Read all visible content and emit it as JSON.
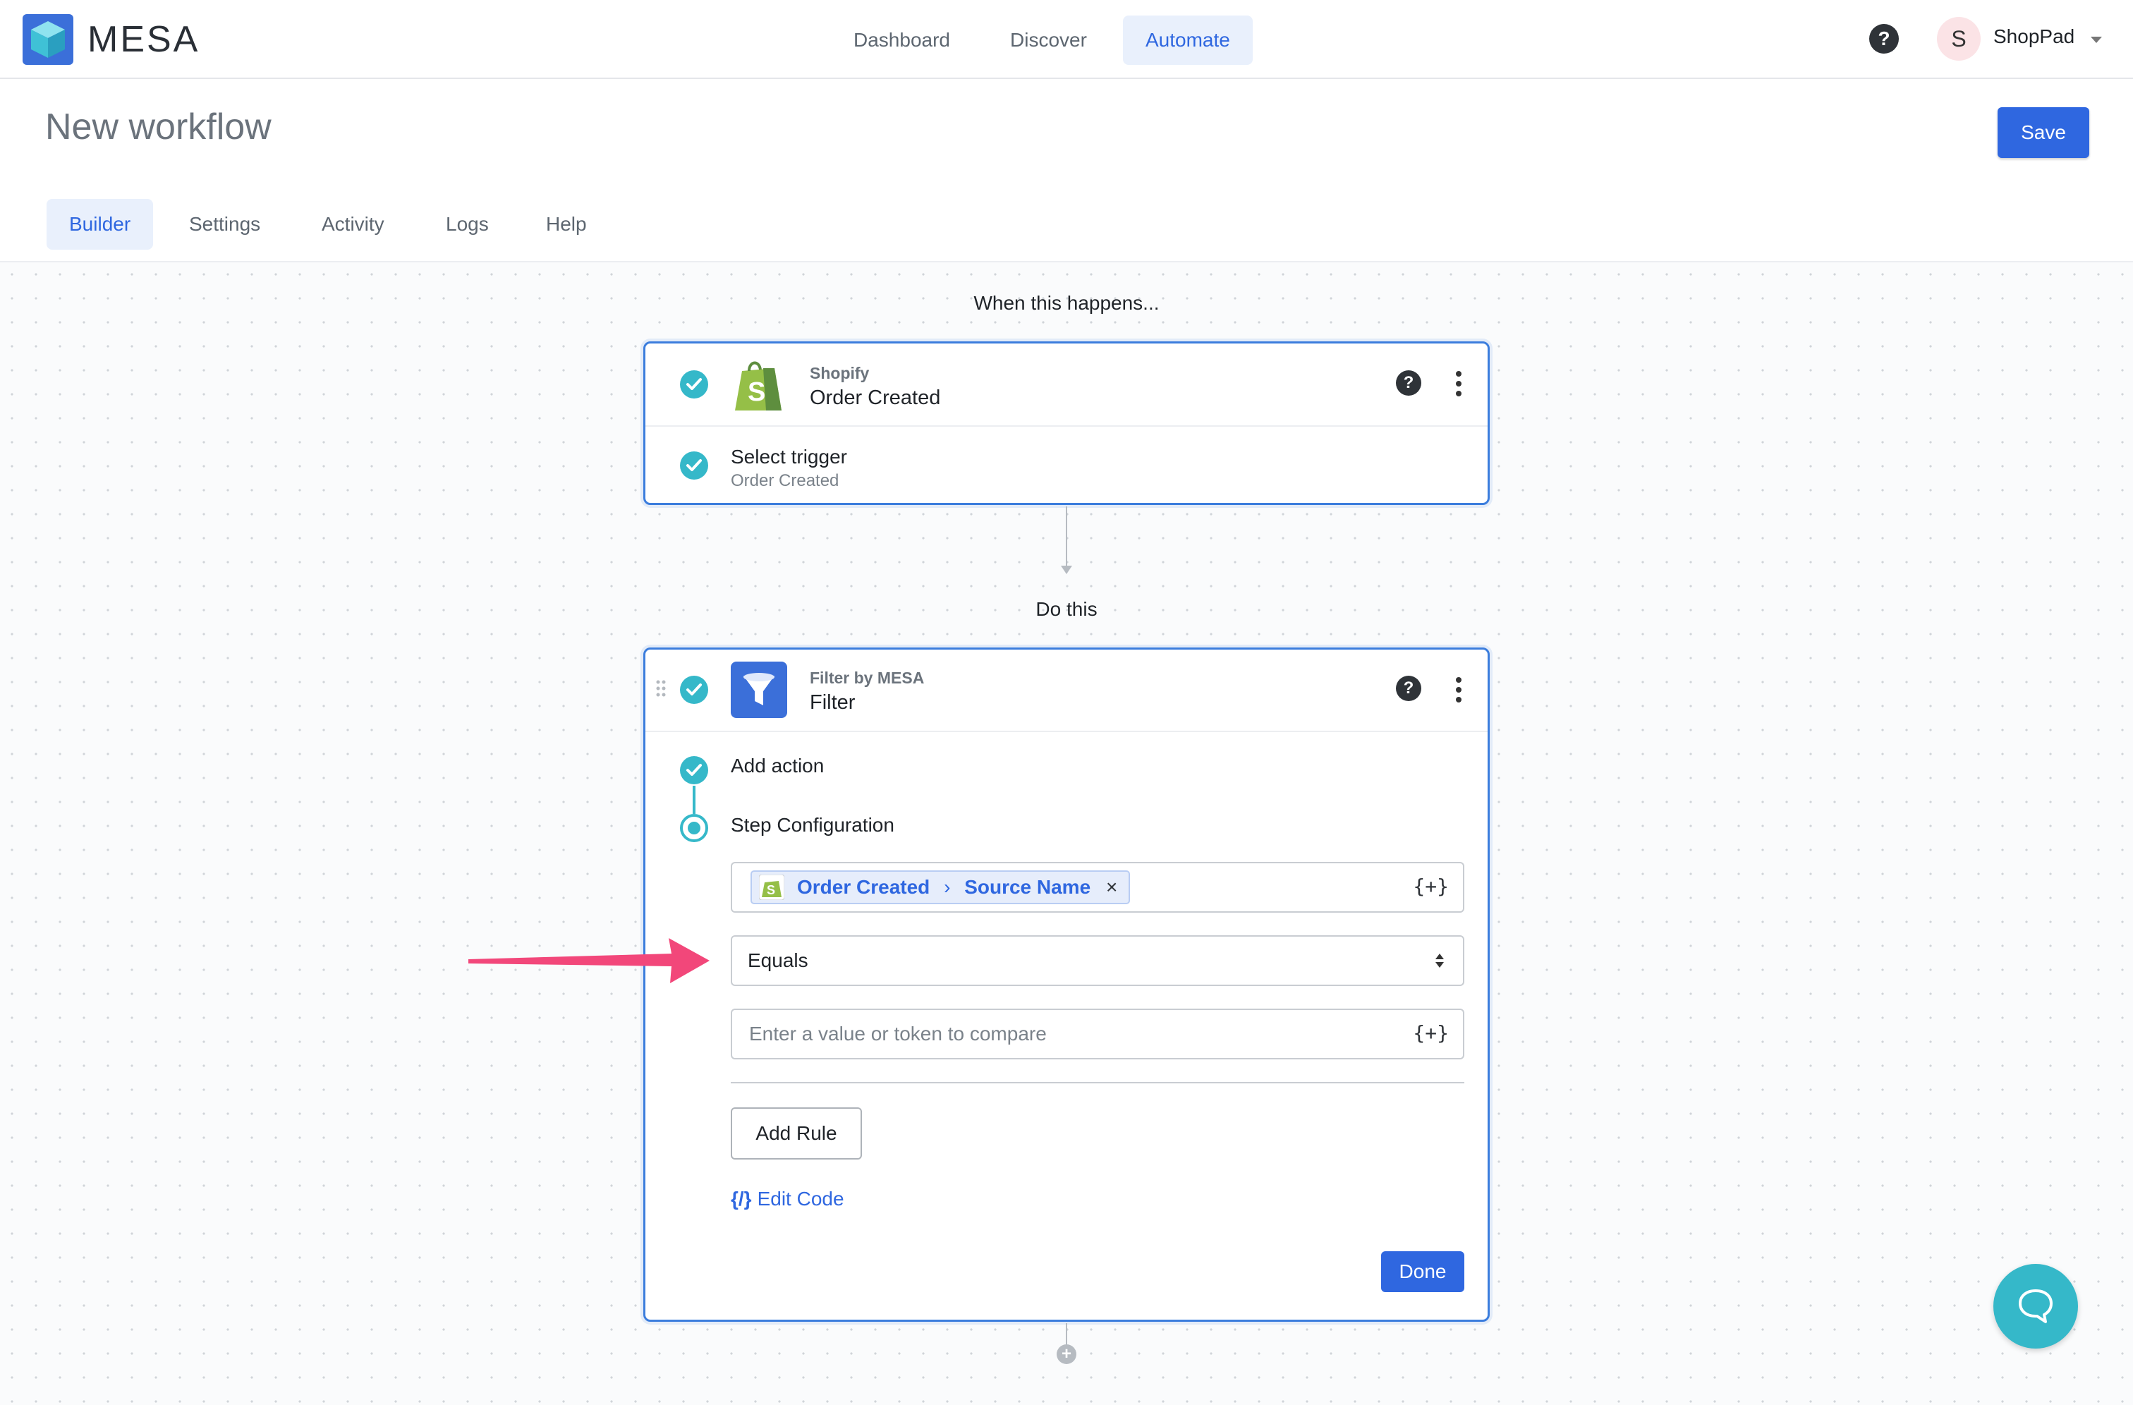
{
  "app": {
    "brand": "MESA",
    "accent": "#2f67e0",
    "teal": "#35b8c9"
  },
  "nav": {
    "tabs": [
      {
        "label": "Dashboard",
        "active": false
      },
      {
        "label": "Discover",
        "active": false
      },
      {
        "label": "Automate",
        "active": true
      }
    ],
    "help_icon": "question-circle-icon",
    "user_initial": "S",
    "shop_name": "ShopPad"
  },
  "header": {
    "title": "New workflow",
    "save_label": "Save"
  },
  "subtabs": [
    {
      "label": "Builder",
      "active": true
    },
    {
      "label": "Settings",
      "active": false
    },
    {
      "label": "Activity",
      "active": false
    },
    {
      "label": "Logs",
      "active": false
    },
    {
      "label": "Help",
      "active": false
    }
  ],
  "trigger": {
    "section_label": "When this happens...",
    "app_name": "Shopify",
    "event": "Order Created",
    "step_title": "Select trigger",
    "step_value": "Order Created"
  },
  "action": {
    "section_label": "Do this",
    "app_name": "Filter by MESA",
    "name": "Filter",
    "steps": [
      "Add action",
      "Step Configuration"
    ],
    "token_chip": {
      "part1": "Order Created",
      "part2": "Source Name"
    },
    "token_button": "{+}",
    "operator_value": "Equals",
    "compare_placeholder": "Enter a value or token to compare",
    "add_rule_label": "Add Rule",
    "edit_code_icon": "{/}",
    "edit_code_label": "Edit Code",
    "done_label": "Done"
  }
}
